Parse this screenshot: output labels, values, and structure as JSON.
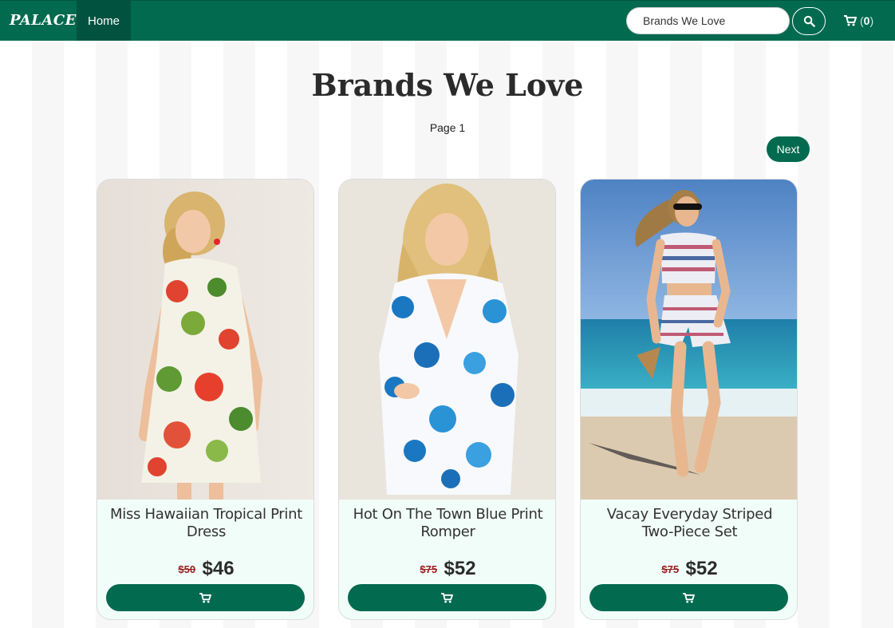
{
  "nav": {
    "brand": "PALACE",
    "home_label": "Home",
    "search_value": "Brands We Love",
    "cart_open": "(",
    "cart_count": "0",
    "cart_close": ")"
  },
  "header": {
    "title": "Brands We Love",
    "page_label": "Page 1",
    "next_label": "Next"
  },
  "colors": {
    "primary": "#026a4f",
    "old_price": "#9b1b1b",
    "card_bg": "#f1fdf8"
  },
  "products": [
    {
      "name": "Miss Hawaiian Tropical Print Dress",
      "old_price": "$50",
      "price": "$46",
      "image_icon": "floral-dress-photo"
    },
    {
      "name": "Hot On The Town Blue Print Romper",
      "old_price": "$75",
      "price": "$52",
      "image_icon": "blue-romper-photo"
    },
    {
      "name": "Vacay Everyday Striped Two-Piece Set",
      "old_price": "$75",
      "price": "$52",
      "image_icon": "striped-set-photo"
    }
  ]
}
